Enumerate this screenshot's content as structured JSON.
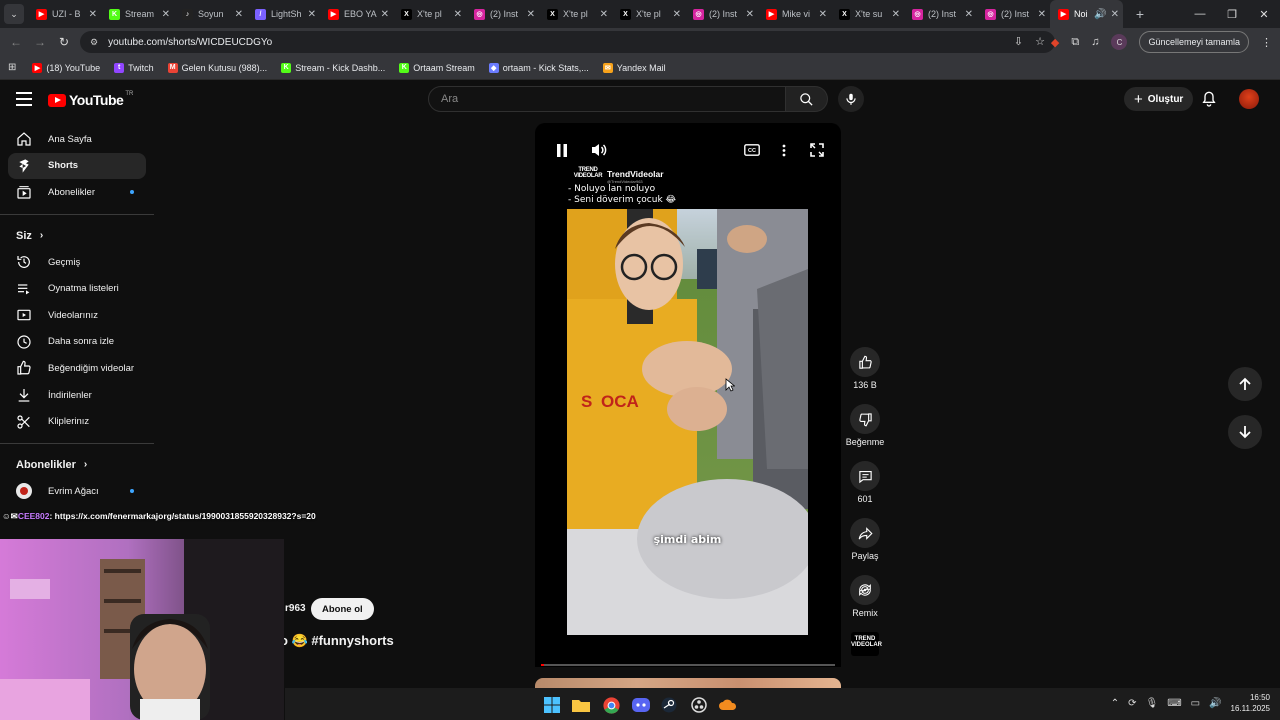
{
  "browser": {
    "tabs": [
      {
        "label": "UZI - B",
        "fav_color": "#ff0000",
        "fav_glyph": "▶"
      },
      {
        "label": "Stream",
        "fav_color": "#53fc18",
        "fav_glyph": "K"
      },
      {
        "label": "Soyun",
        "fav_color": "#222222",
        "fav_glyph": "♪"
      },
      {
        "label": "LightSh",
        "fav_color": "#7b61ff",
        "fav_glyph": "/"
      },
      {
        "label": "EBO YA",
        "fav_color": "#ff0000",
        "fav_glyph": "▶"
      },
      {
        "label": "X'te pl",
        "fav_color": "#000000",
        "fav_glyph": "X"
      },
      {
        "label": "(2) Inst",
        "fav_color": "#d6249f",
        "fav_glyph": "◎"
      },
      {
        "label": "X'te pl",
        "fav_color": "#000000",
        "fav_glyph": "X"
      },
      {
        "label": "X'te pl",
        "fav_color": "#000000",
        "fav_glyph": "X"
      },
      {
        "label": "(2) Inst",
        "fav_color": "#d6249f",
        "fav_glyph": "◎"
      },
      {
        "label": "Mike vi",
        "fav_color": "#ff0000",
        "fav_glyph": "▶"
      },
      {
        "label": "X'te su",
        "fav_color": "#000000",
        "fav_glyph": "X"
      },
      {
        "label": "(2) Inst",
        "fav_color": "#d6249f",
        "fav_glyph": "◎"
      },
      {
        "label": "(2) Inst",
        "fav_color": "#d6249f",
        "fav_glyph": "◎"
      },
      {
        "label": "Noi",
        "fav_color": "#ff0000",
        "fav_glyph": "▶",
        "active": true
      }
    ],
    "url": "youtube.com/shorts/WICDEUCDGYo",
    "update_label": "Güncellemeyi tamamla",
    "profile_initial": "C",
    "bookmarks": [
      {
        "label": "(18) YouTube",
        "color": "#ff0000",
        "glyph": "▶"
      },
      {
        "label": "Twitch",
        "color": "#9146ff",
        "glyph": "t"
      },
      {
        "label": "Gelen Kutusu (988)...",
        "color": "#ea4335",
        "glyph": "M"
      },
      {
        "label": "Stream - Kick Dashb...",
        "color": "#53fc18",
        "glyph": "K"
      },
      {
        "label": "Ortaam Stream",
        "color": "#53fc18",
        "glyph": "K"
      },
      {
        "label": "ortaam - Kick Stats,...",
        "color": "#6b7cff",
        "glyph": "◆"
      },
      {
        "label": "Yandex Mail",
        "color": "#f7a21b",
        "glyph": "✉"
      }
    ]
  },
  "header": {
    "logo_text": "YouTube",
    "logo_region": "TR",
    "search_placeholder": "Ara",
    "create_label": "Oluştur"
  },
  "sidebar": {
    "main": [
      {
        "label": "Ana Sayfa",
        "icon": "home-icon"
      },
      {
        "label": "Shorts",
        "icon": "shorts-icon",
        "active": true
      },
      {
        "label": "Abonelikler",
        "icon": "subscriptions-icon",
        "dot": true
      }
    ],
    "you_heading": "Siz",
    "you": [
      {
        "label": "Geçmiş",
        "icon": "history-icon"
      },
      {
        "label": "Oynatma listeleri",
        "icon": "playlists-icon"
      },
      {
        "label": "Videolarınız",
        "icon": "your-videos-icon"
      },
      {
        "label": "Daha sonra izle",
        "icon": "watch-later-icon"
      },
      {
        "label": "Beğendiğim videolar",
        "icon": "liked-icon"
      },
      {
        "label": "İndirilenler",
        "icon": "downloads-icon"
      },
      {
        "label": "Kliplerinız",
        "icon": "clips-icon"
      }
    ],
    "subs_heading": "Abonelikler",
    "subs": [
      {
        "label": "Evrim Ağacı",
        "dot": true
      }
    ]
  },
  "short": {
    "channel_name": "TrendVideolar",
    "channel_handle": "@TrendVideolar963",
    "logo_text_1": "TREND",
    "logo_text_2": "VIDEOLAR",
    "dialog_line_1": "-  Noluyo lan noluyo",
    "dialog_line_2": "-  Seni döverim çocuk  😂",
    "subtitle": "şimdi abim",
    "progress": 0.01
  },
  "actions": {
    "likes": "136 B",
    "dislike_label": "Beğenme",
    "comments": "601",
    "share_label": "Paylaş",
    "remix_label": "Remix"
  },
  "below": {
    "handle_fragment": "r963",
    "subscribe_label": "Abone ol",
    "title_fragment": "o 😂 #funnyshorts"
  },
  "stream_chat": {
    "user": "CEE802",
    "message": ": https://x.com/fenermarkajorg/status/1990031855920328932?s=20"
  },
  "taskbar": {
    "time": "16:50",
    "date": "16.11.2025"
  }
}
